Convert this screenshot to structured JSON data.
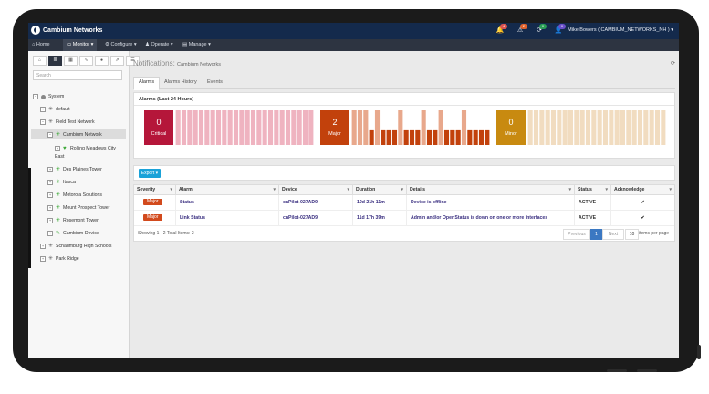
{
  "app": {
    "brand": "Cambium Networks",
    "user": "Mike Bowers ( CAMBIUM_NETWORKS_NH )"
  },
  "notifications": [
    {
      "icon": "bell-icon",
      "count": "4",
      "color": "#d9534f"
    },
    {
      "icon": "alert-icon",
      "count": "2",
      "color": "#e0622c"
    },
    {
      "icon": "refresh-icon",
      "count": "0",
      "color": "#2a9d55"
    },
    {
      "icon": "user-icon",
      "count": "0",
      "color": "#6a4fc9"
    }
  ],
  "nav": {
    "home": "Home",
    "monitor": "Monitor",
    "configure": "Configure",
    "operate": "Operate",
    "manage": "Manage"
  },
  "sidebar": {
    "search_placeholder": "Search",
    "tree": {
      "system": "System",
      "default": "default",
      "field_test_network": "Field Test Network",
      "cambium_network": "Cambium Network",
      "rolling_meadows": "Rolling Meadows City",
      "east": "East",
      "des_plaines": "Des Plaines Tower",
      "itasca": "Itasca",
      "motorola": "Motorola Solutions",
      "mount_prospect": "Mount Prospect Tower",
      "rosemont": "Rosemont Tower",
      "cambium_device": "Cambium-Device",
      "schaumburg": "Schaumburg High Schools",
      "park_ridge": "Park Ridge"
    }
  },
  "page": {
    "title": "Notifications:",
    "subtitle": "Cambium Networks"
  },
  "tabs": {
    "alarms": "Alarms",
    "alarms_history": "Alarms History",
    "events": "Events"
  },
  "alarms_panel": {
    "title": "Alarms (Last 24 Hours)",
    "critical": {
      "count": "0",
      "label": "Critical",
      "color": "#b5163a"
    },
    "major": {
      "count": "2",
      "label": "Major",
      "color": "#c2410c"
    },
    "minor": {
      "count": "0",
      "label": "Minor",
      "color": "#c88a10"
    }
  },
  "export_label": "Export",
  "table": {
    "headers": {
      "severity": "Severity",
      "alarm": "Alarm",
      "device": "Device",
      "duration": "Duration",
      "details": "Details",
      "status": "Status",
      "ack": "Acknowledge"
    },
    "rows": [
      {
        "severity": "Major",
        "alarm": "Status",
        "device": "cnPilot-027AD9",
        "duration": "10d 21h 11m",
        "details": "Device is offline",
        "status": "ACTIVE",
        "ack": "✔"
      },
      {
        "severity": "Major",
        "alarm": "Link Status",
        "device": "cnPilot-027AD9",
        "duration": "11d 17h 39m",
        "details": "Admin and/or Oper Status is down on one or more interfaces",
        "status": "ACTIVE",
        "ack": "✔"
      }
    ],
    "footer": {
      "showing": "Showing 1 - 2  Total Items: 2",
      "previous": "Previous",
      "page": "1",
      "next": "Next",
      "page_size": "10",
      "per_page": "items per page"
    }
  }
}
